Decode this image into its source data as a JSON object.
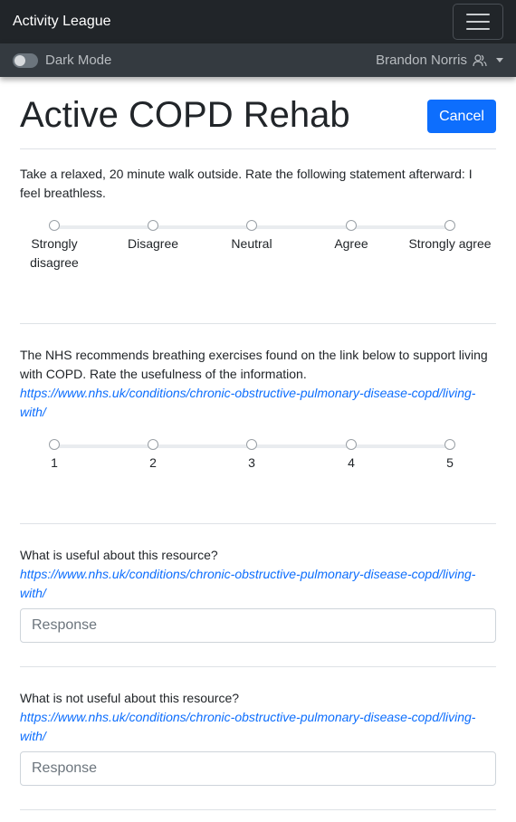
{
  "navbar": {
    "brand": "Activity League",
    "menu_icon": "hamburger-icon"
  },
  "subbar": {
    "dark_mode_label": "Dark Mode",
    "dark_mode_on": false,
    "user_name": "Brandon Norris",
    "user_icon": "users-icon"
  },
  "page": {
    "title": "Active COPD Rehab",
    "cancel_label": "Cancel"
  },
  "questions": [
    {
      "text": "Take a relaxed, 20 minute walk outside. Rate the following statement afterward: I feel breathless.",
      "options": [
        "Strongly disagree",
        "Disagree",
        "Neutral",
        "Agree",
        "Strongly agree"
      ]
    },
    {
      "text": "The NHS recommends breathing exercises found on the link below to support living with COPD. Rate the usefulness of the information.",
      "link": "https://www.nhs.uk/conditions/chronic-obstructive-pulmonary-disease-copd/living-with/",
      "options": [
        "1",
        "2",
        "3",
        "4",
        "5"
      ]
    },
    {
      "text": "What is useful about this resource?",
      "link": "https://www.nhs.uk/conditions/chronic-obstructive-pulmonary-disease-copd/living-with/",
      "placeholder": "Response"
    },
    {
      "text": "What is not useful about this resource?",
      "link": "https://www.nhs.uk/conditions/chronic-obstructive-pulmonary-disease-copd/living-with/",
      "placeholder": "Response"
    }
  ],
  "colors": {
    "navbar": "#212529",
    "subbar": "#343a40",
    "primary": "#0d6efd"
  }
}
